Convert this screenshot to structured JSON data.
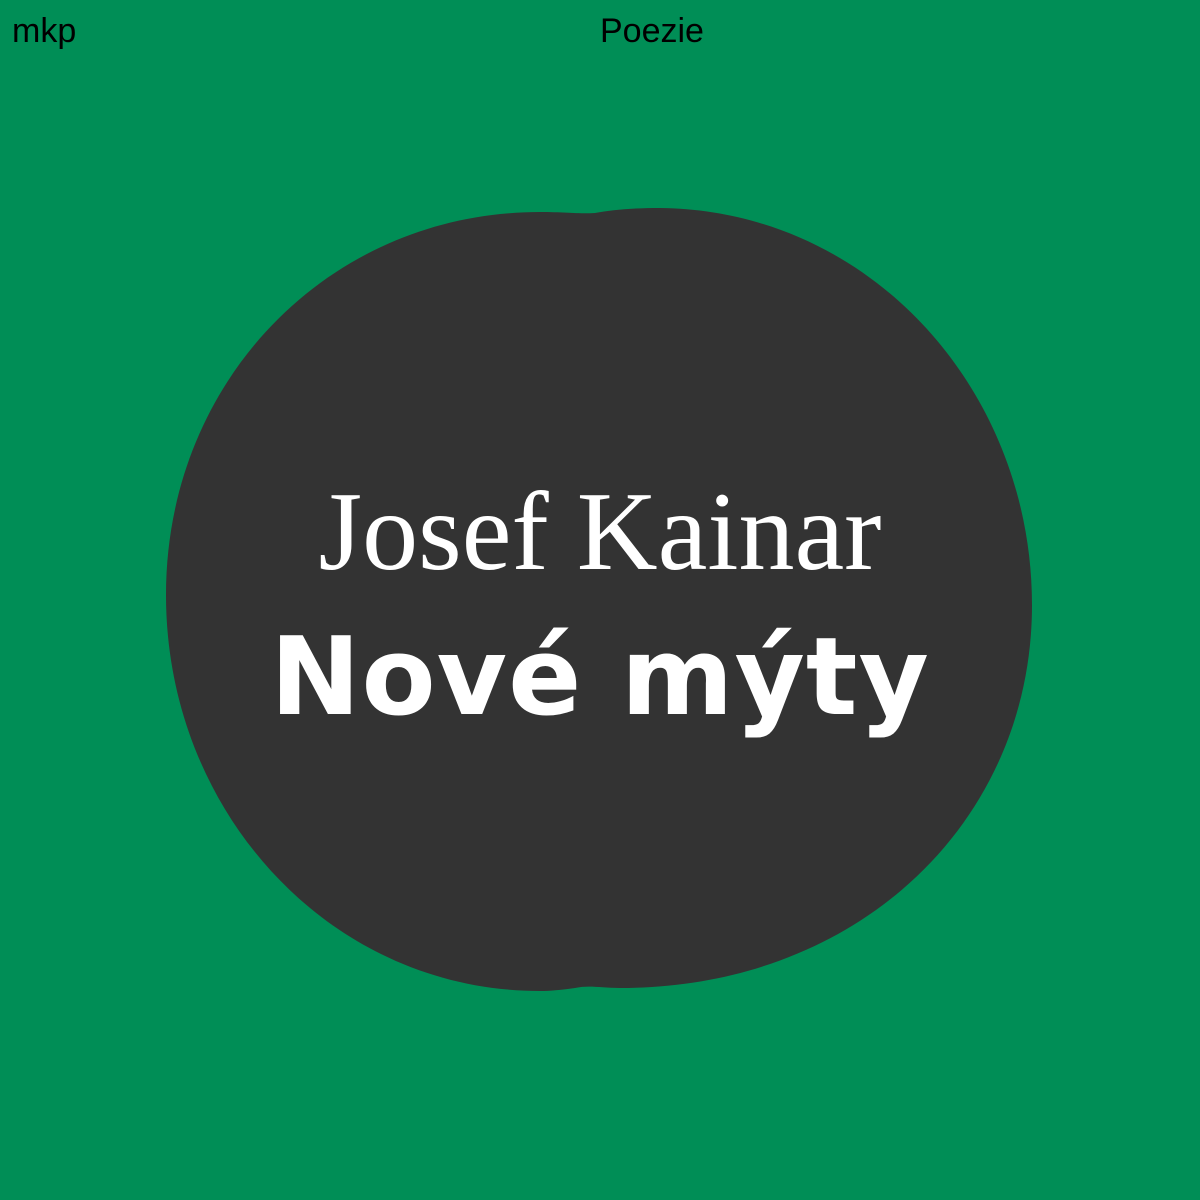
{
  "header": {
    "publisher": "mkp",
    "genre": "Poezie"
  },
  "book": {
    "author": "Josef Kainar",
    "title": "Nové mýty"
  },
  "colors": {
    "background": "#008e56",
    "blob": "#333333",
    "text_light": "#ffffff",
    "text_dark": "#000000"
  }
}
